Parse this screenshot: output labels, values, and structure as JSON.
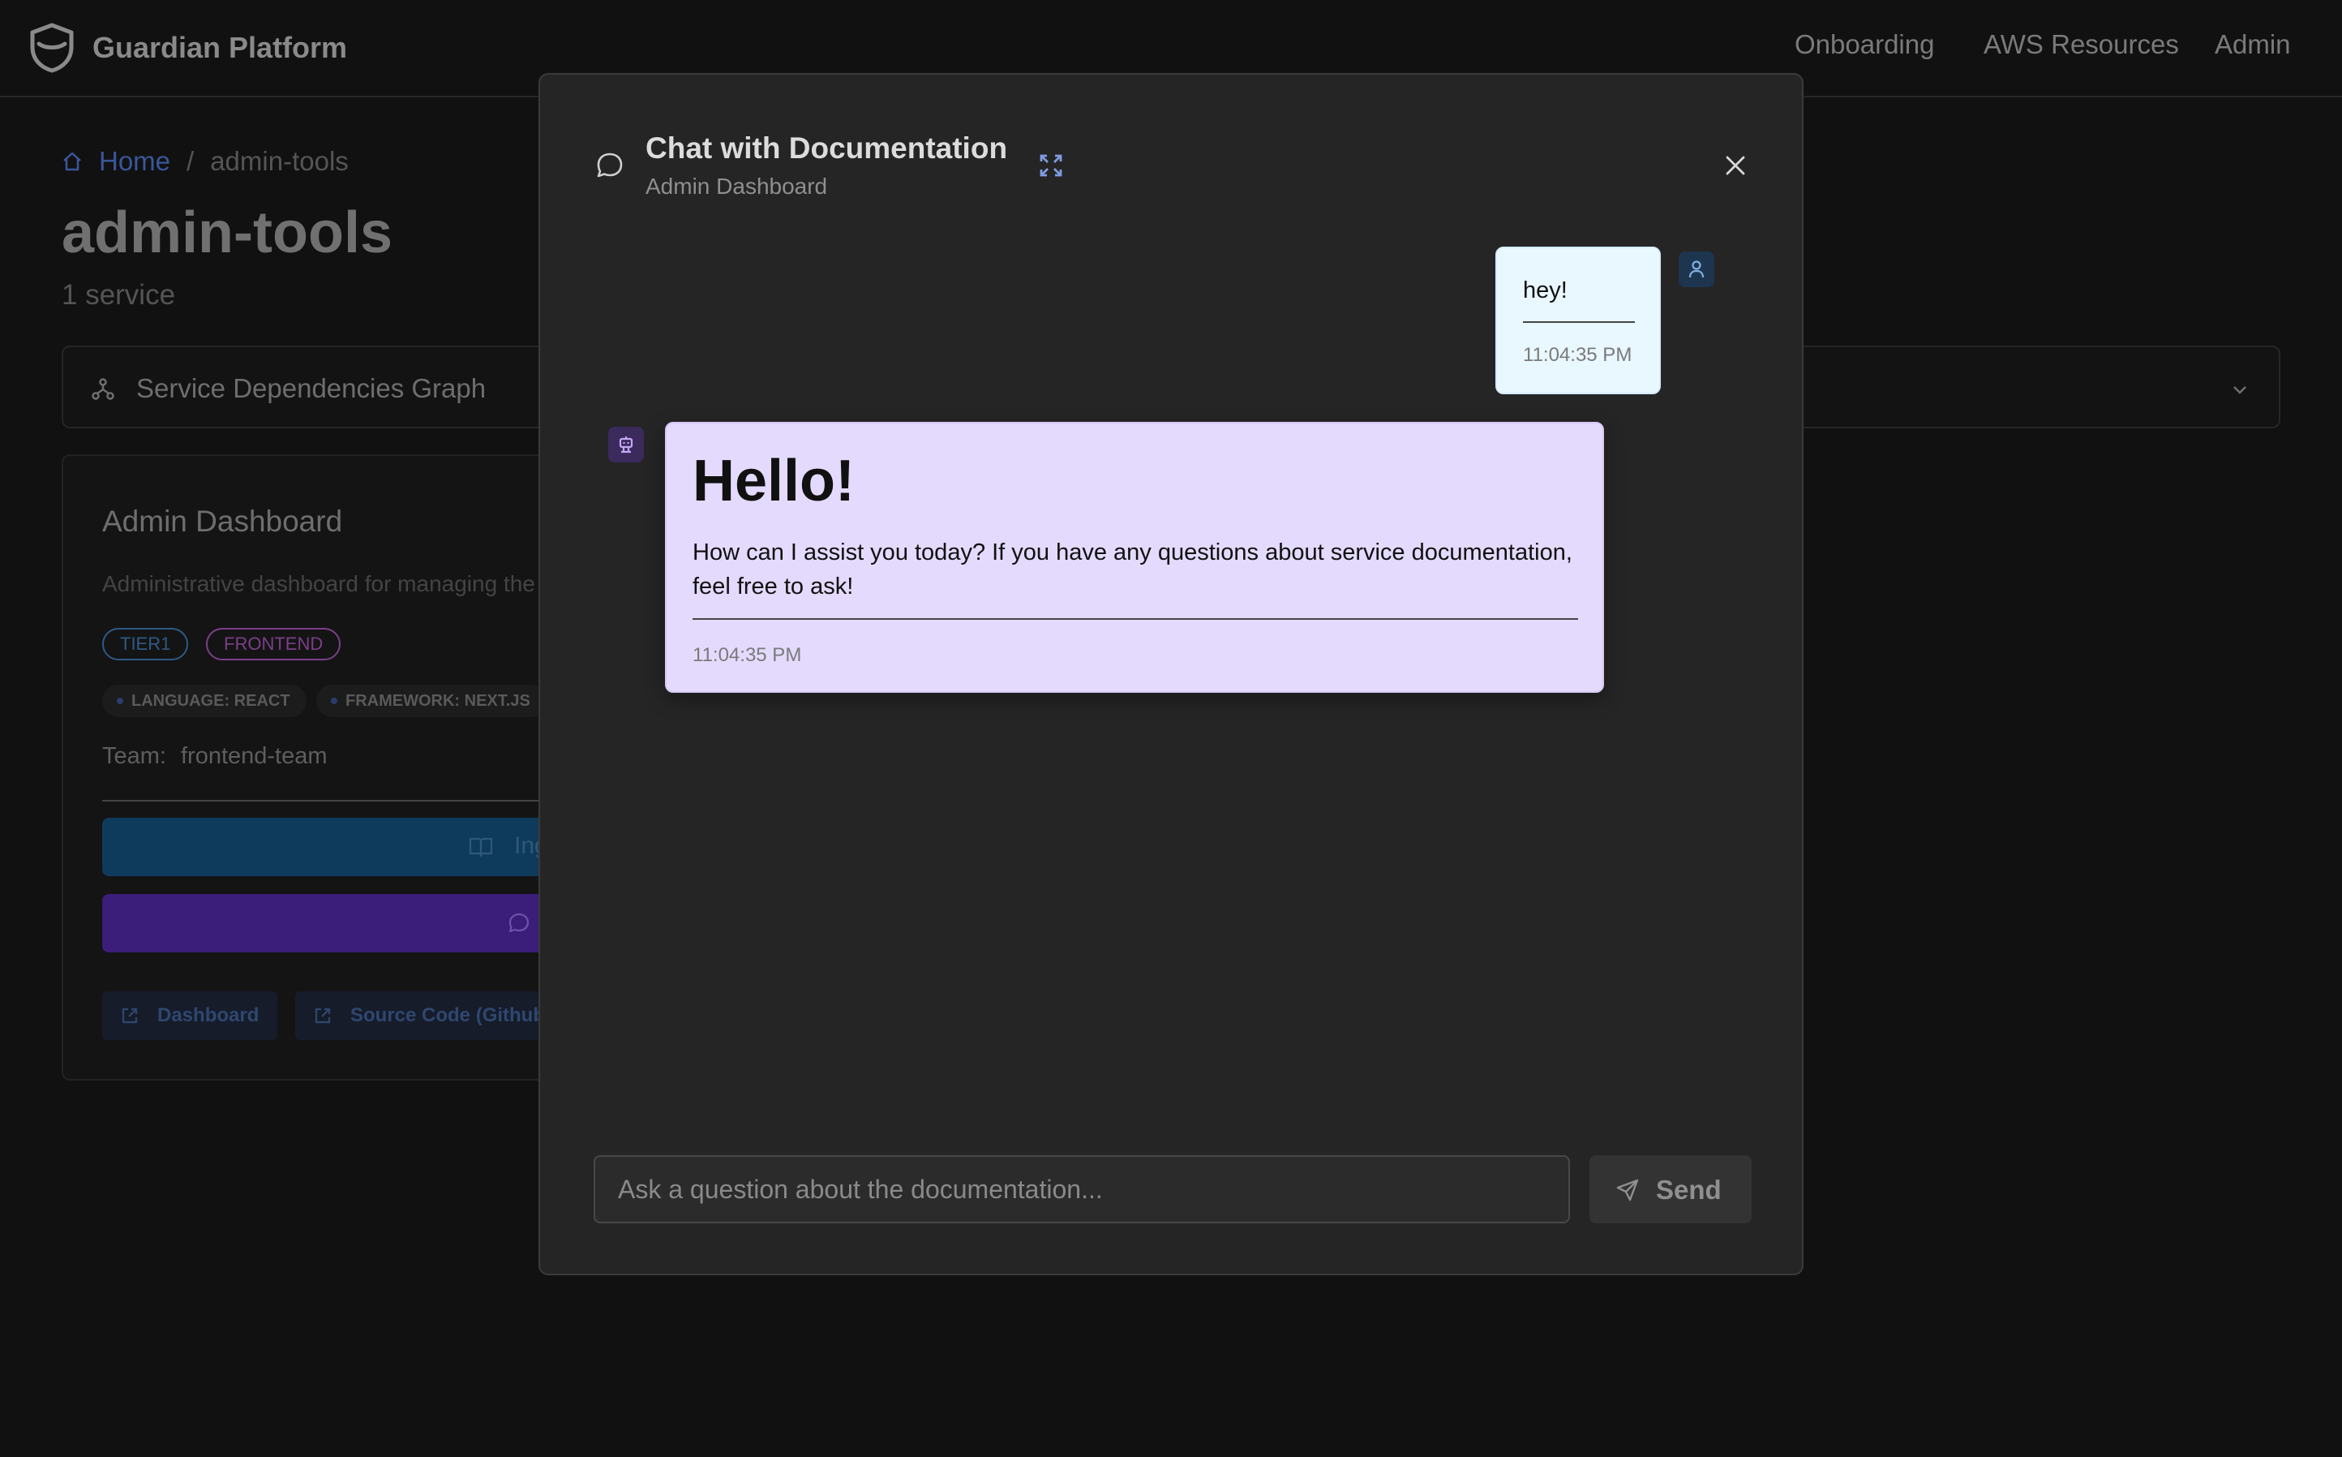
{
  "header": {
    "brand": "Guardian Platform",
    "nav": [
      "Onboarding",
      "AWS Resources",
      "Admin"
    ]
  },
  "breadcrumb": {
    "home": "Home",
    "separator": "/",
    "current": "admin-tools"
  },
  "page": {
    "title": "admin-tools",
    "subtitle": "1 service"
  },
  "dependencies": {
    "label": "Service Dependencies Graph"
  },
  "service_card": {
    "title": "Admin Dashboard",
    "description": "Administrative dashboard for managing the p",
    "tags": [
      "TIER1",
      "FRONTEND"
    ],
    "meta": [
      "LANGUAGE: REACT",
      "FRAMEWORK: NEXT.JS"
    ],
    "team_label": "Team:",
    "team_value": "frontend-team",
    "ingest_label": "Ing",
    "links": [
      "Dashboard",
      "Source Code (Github)"
    ]
  },
  "modal": {
    "title": "Chat with Documentation",
    "subtitle": "Admin Dashboard",
    "messages": [
      {
        "role": "user",
        "text": "hey!",
        "time": "11:04:35 PM"
      },
      {
        "role": "assistant",
        "heading": "Hello!",
        "text": "How can I assist you today? If you have any questions about service documentation, feel free to ask!",
        "time": "11:04:35 PM"
      }
    ],
    "input_placeholder": "Ask a question about the documentation...",
    "send_label": "Send"
  },
  "colors": {
    "user_bubble": "#e9f7ff",
    "assistant_bubble": "#e4dafd",
    "accent_link": "#3a5699"
  }
}
